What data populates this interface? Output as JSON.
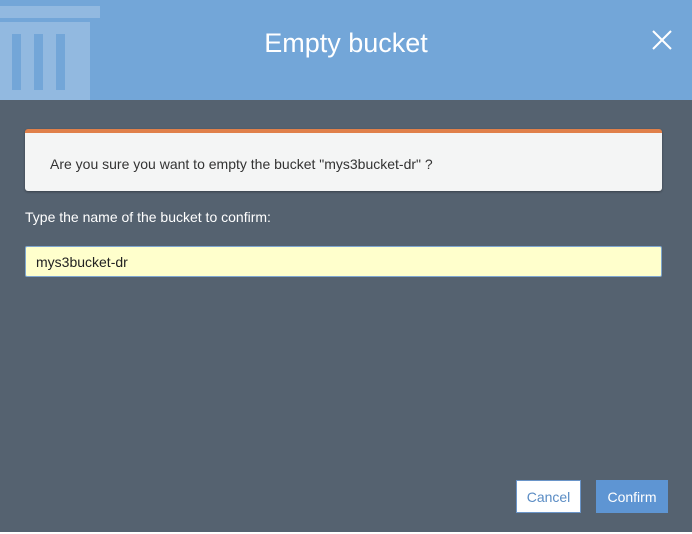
{
  "dialog": {
    "title": "Empty bucket",
    "close_icon": "close-icon",
    "watermark_icon": "trash-icon"
  },
  "alert": {
    "message": "Are you sure you want to empty the bucket \"mys3bucket-dr\" ?",
    "accent_color": "#e0804a"
  },
  "form": {
    "label": "Type the name of the bucket to confirm:",
    "input_value": "mys3bucket-dr"
  },
  "buttons": {
    "cancel_label": "Cancel",
    "confirm_label": "Confirm"
  },
  "colors": {
    "header": "#73a6d8",
    "body": "#556270",
    "primary_button": "#5e95d3",
    "input_bg": "#ffffcc"
  }
}
